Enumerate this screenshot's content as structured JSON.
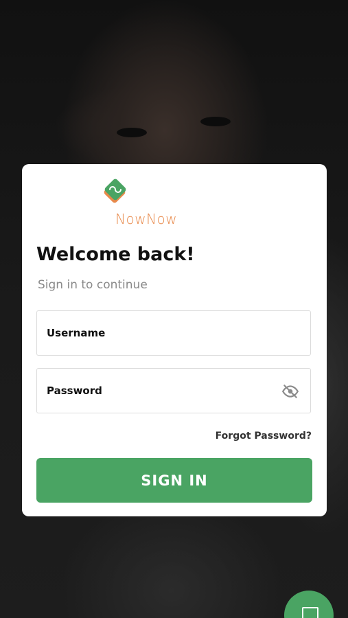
{
  "brand": {
    "name": "NowNow",
    "logo_color": "#e8894a",
    "mark_colors": [
      "#4aa463",
      "#e8894a"
    ]
  },
  "login": {
    "title": "Welcome back!",
    "subtitle": "Sign in to continue",
    "username_placeholder": "Username",
    "password_placeholder": "Password",
    "password_toggle_icon": "eye-off-icon",
    "forgot_label": "Forgot Password?",
    "submit_label": "SIGN IN"
  },
  "fab": {
    "icon": "chat-icon"
  },
  "colors": {
    "accent": "#4aa463",
    "background": "#141414",
    "card": "#ffffff"
  }
}
